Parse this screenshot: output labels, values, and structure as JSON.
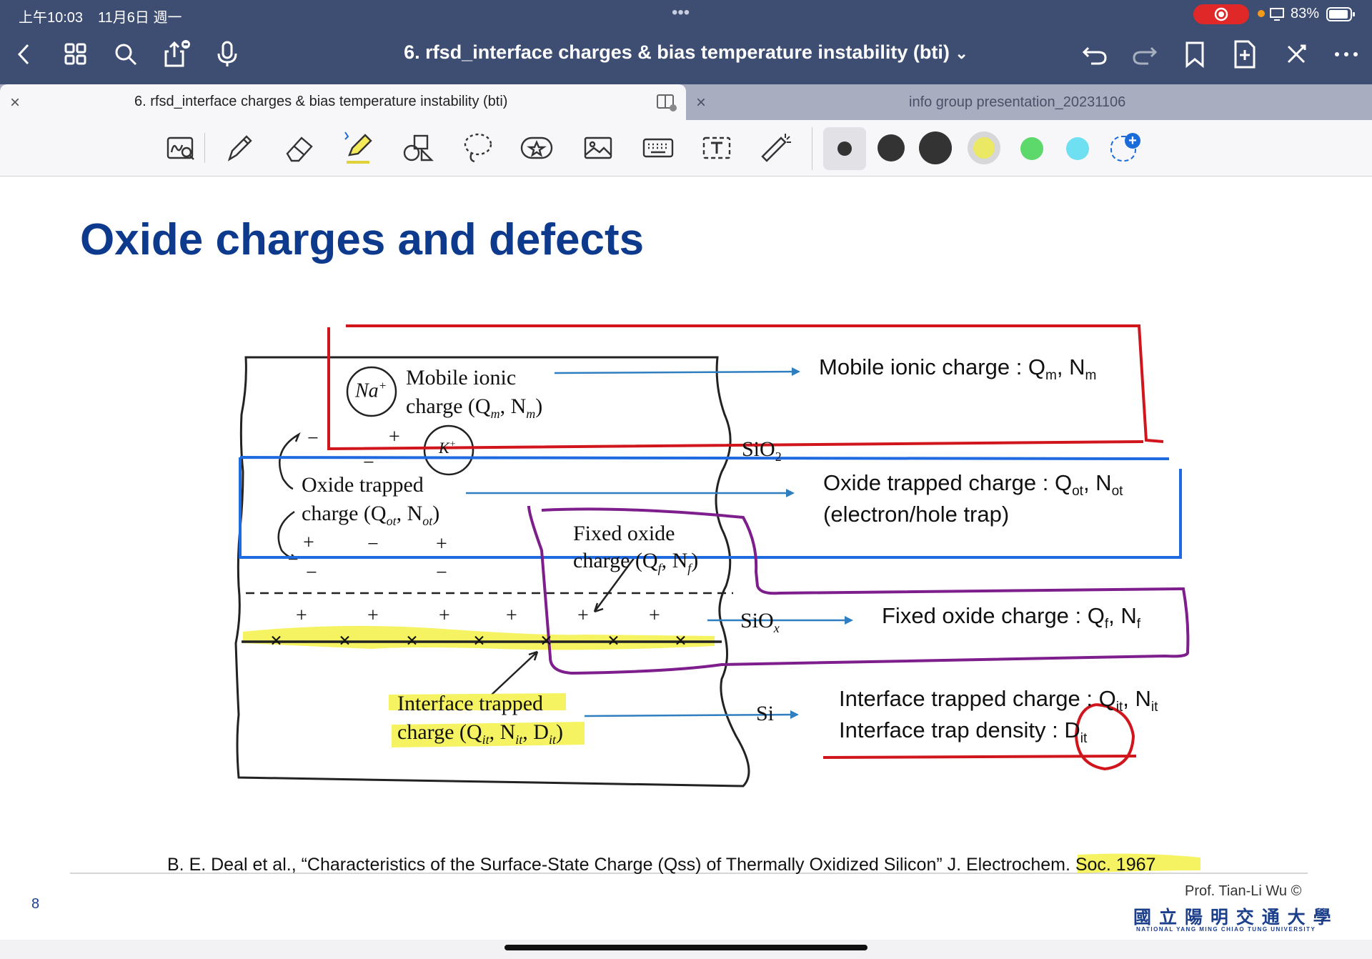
{
  "status": {
    "time": "上午10:03",
    "date": "11月6日 週一",
    "battery": "83%",
    "dots": "•••"
  },
  "header": {
    "title": "6. rfsd_interface charges & bias temperature instability (bti)",
    "title_chevron": "⌄"
  },
  "tabs": [
    {
      "label": "6. rfsd_interface charges & bias temperature instability (bti)",
      "close": "×"
    },
    {
      "label": "info group presentation_20231106",
      "close": "×"
    }
  ],
  "toolbar": {
    "colors": [
      "#333333",
      "#333333",
      "#333333",
      "#e8e66a",
      "#5dd86a",
      "#6ee0f2"
    ],
    "add_color": "+"
  },
  "slide": {
    "title": "Oxide charges and defects",
    "page_number": "8",
    "reference": "B. E. Deal et al., “Characteristics of the Surface-State Charge (Qss) of Thermally Oxidized Silicon” J. Electrochem. Soc. 1967",
    "author": "Prof. Tian-Li Wu ©",
    "university_cn": "國 立 陽 明 交 通 大 學",
    "university_en": "NATIONAL YANG MING CHIAO TUNG UNIVERSITY",
    "diagram": {
      "na": "Na",
      "na_sup": "+",
      "k": "K",
      "k_sup": "+",
      "mobile_l1": "Mobile ionic",
      "mobile_l2": "charge (Q",
      "mobile_sub1": "m",
      "mobile_mid": ", N",
      "mobile_sub2": "m",
      "mobile_end": ")",
      "oxide_l1": "Oxide trapped",
      "oxide_l2": "charge (Q",
      "oxide_sub1": "ot",
      "oxide_mid": ", N",
      "oxide_sub2": "ot",
      "oxide_end": ")",
      "fixed_l1": "Fixed oxide",
      "fixed_l2": "charge (Q",
      "fixed_sub1": "f",
      "fixed_mid": ", N",
      "fixed_sub2": "f",
      "fixed_end": ")",
      "interface_l1": "Interface trapped",
      "interface_l2": "charge (Q",
      "interface_sub1": "it",
      "interface_mid": ", N",
      "interface_sub2": "it",
      "interface_mid2": ", D",
      "interface_sub3": "it",
      "interface_end": ")",
      "sio2": "SiO",
      "sio2_sub": "2",
      "siox": "SiO",
      "siox_sub": "x",
      "si": "Si",
      "plus": "+",
      "minus": "−",
      "cross": "×"
    },
    "labels": {
      "mobile": "Mobile ionic charge : Q",
      "mobile_sub1": "m",
      "mobile_mid": ", N",
      "mobile_sub2": "m",
      "oxide": "Oxide trapped charge : Q",
      "oxide_sub1": "ot",
      "oxide_mid": ", N",
      "oxide_sub2": "ot",
      "oxide_l2": "(electron/hole trap)",
      "fixed": "Fixed oxide charge : Q",
      "fixed_sub1": "f",
      "fixed_mid": ", N",
      "fixed_sub2": "f",
      "interface": "Interface trapped charge : Q",
      "interface_sub1": "it",
      "interface_mid": ", N",
      "interface_sub2": "it",
      "density": "Interface trap density : D",
      "density_sub": "it"
    }
  }
}
